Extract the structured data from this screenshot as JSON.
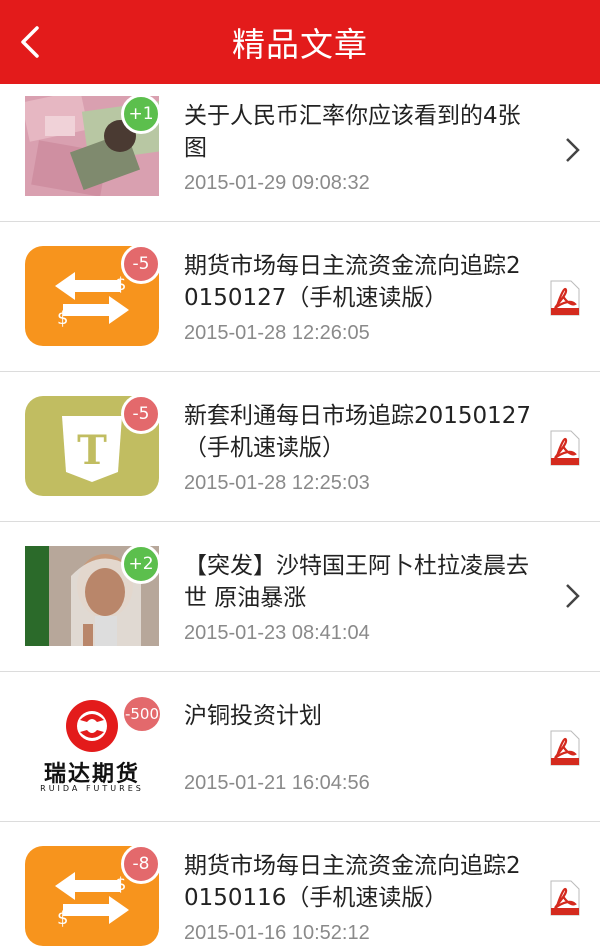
{
  "header": {
    "title": "精品文章",
    "back_icon": "chevron-left-icon",
    "bg_color": "#e31b1b"
  },
  "articles": [
    {
      "title": "关于人民币汇率你应该看到的4张图",
      "date": "2015-01-29 09:08:32",
      "badge": "+1",
      "badge_color": "#5cbf4d",
      "thumb": "currency-photo",
      "action": "chevron-right-icon"
    },
    {
      "title": "期货市场每日主流资金流向追踪20150127（手机速读版）",
      "date": "2015-01-28 12:26:05",
      "badge": "-5",
      "badge_color": "#e3696c",
      "thumb": "exchange-icon-orange",
      "action": "pdf-icon"
    },
    {
      "title": "新套利通每日市场追踪20150127（手机速读版）",
      "date": "2015-01-28 12:25:03",
      "badge": "-5",
      "badge_color": "#e3696c",
      "thumb": "t-icon-olive",
      "action": "pdf-icon"
    },
    {
      "title": "【突发】沙特国王阿卜杜拉凌晨去世 原油暴涨",
      "date": "2015-01-23 08:41:04",
      "badge": "+2",
      "badge_color": "#5cbf4d",
      "thumb": "king-photo",
      "action": "chevron-right-icon"
    },
    {
      "title": "沪铜投资计划",
      "date": "2015-01-21 16:04:56",
      "badge": "-500",
      "badge_color": "#e3696c",
      "thumb": "ruida-logo",
      "logo_text": "瑞达期货",
      "logo_subtext": "RUIDA FUTURES",
      "action": "pdf-icon"
    },
    {
      "title": "期货市场每日主流资金流向追踪20150116（手机速读版）",
      "date": "2015-01-16 10:52:12",
      "badge": "-8",
      "badge_color": "#e3696c",
      "thumb": "exchange-icon-orange",
      "action": "pdf-icon"
    }
  ]
}
